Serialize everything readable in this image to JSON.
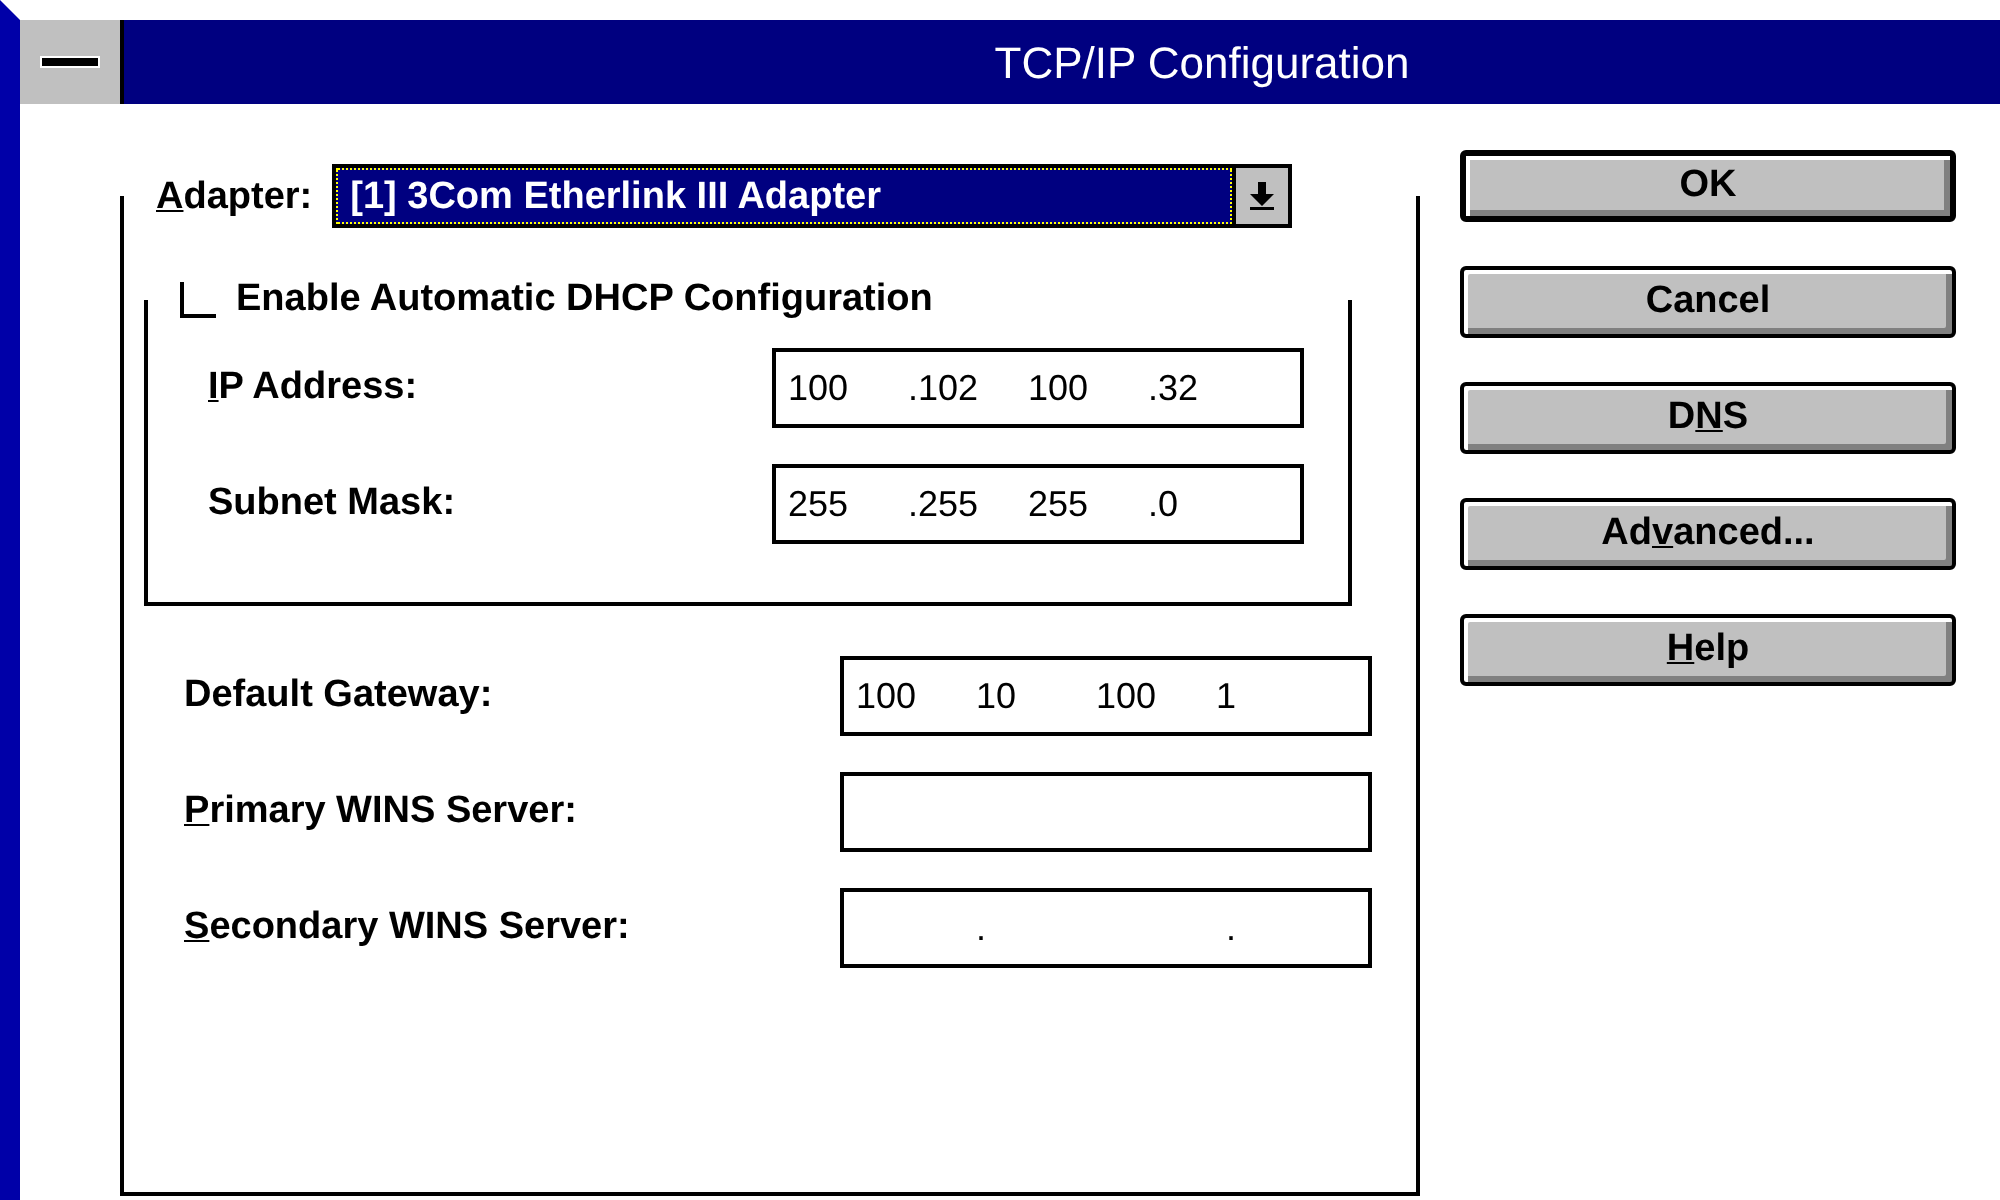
{
  "window": {
    "title": "TCP/IP Configuration"
  },
  "adapter": {
    "label": {
      "key": "A",
      "after": "dapter:"
    },
    "value": "[1] 3Com Etherlink III Adapter"
  },
  "dhcp": {
    "label": "Enable Automatic DHCP Configuration",
    "checked": false
  },
  "inner_fields": [
    {
      "label": {
        "key": "I",
        "after": "P Address:"
      },
      "value": [
        "100",
        ".102",
        "100",
        ".32"
      ]
    },
    {
      "label": {
        "after": "Subnet Mask:"
      },
      "value": [
        "255",
        ".255",
        "255",
        ".0"
      ]
    }
  ],
  "outer_fields": [
    {
      "label": {
        "after": "Default Gateway:"
      },
      "value": [
        "100",
        "10",
        "100",
        "1"
      ]
    },
    {
      "label": {
        "key": "P",
        "after": "rimary WINS Server:"
      }
    },
    {
      "label": {
        "key": "S",
        "after": "econdary WINS Server:"
      },
      "value": [
        ".",
        "."
      ]
    }
  ],
  "buttons": [
    {
      "label": {
        "after": "OK"
      },
      "default": true
    },
    {
      "label": {
        "after": "Cancel"
      },
      "default": false
    },
    {
      "label": {
        "before": "D",
        "key": "N",
        "after": "S"
      },
      "default": false
    },
    {
      "label": {
        "before": "Ad",
        "key": "v",
        "after": "anced..."
      },
      "default": false
    },
    {
      "label": {
        "key": "H",
        "after": "elp"
      },
      "default": false
    }
  ]
}
